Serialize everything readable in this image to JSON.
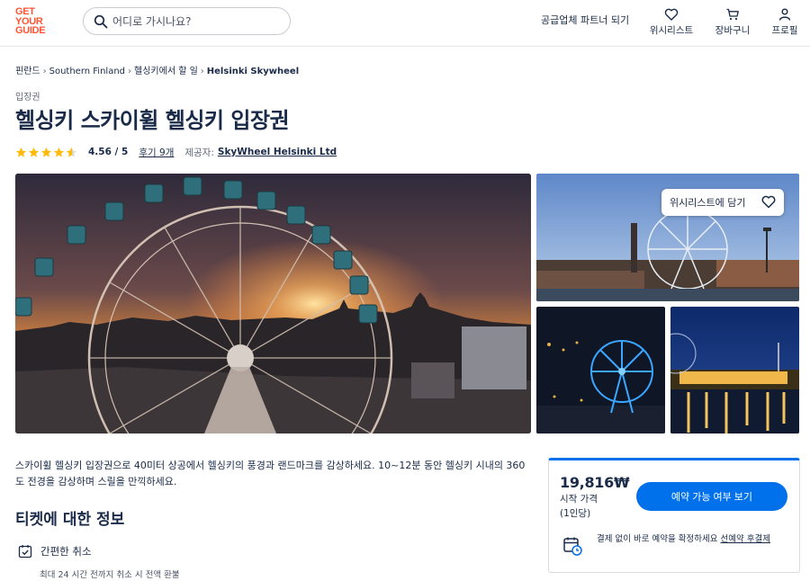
{
  "header": {
    "logo_lines": [
      "GET",
      "YOUR",
      "GUIDE"
    ],
    "search_placeholder": "어디로 가시나요?",
    "partner_link": "공급업체 파트너 되기",
    "nav": [
      {
        "label": "위시리스트",
        "icon": "heart-icon"
      },
      {
        "label": "장바구니",
        "icon": "cart-icon"
      },
      {
        "label": "프로필",
        "icon": "profile-icon"
      }
    ]
  },
  "breadcrumb": [
    "핀란드",
    "Southern Finland",
    "헬싱키에서 할 일",
    "Helsinki Skywheel"
  ],
  "product": {
    "category": "입장권",
    "title": "헬싱키 스카이휠 헬싱키 입장권",
    "rating_value": "4.56 / 5",
    "rating_stars": 4.56,
    "reviews": "후기 9개",
    "provider_label": "제공자:",
    "provider_name": "SkyWheel Helsinki Ltd"
  },
  "gallery": {
    "wishlist_button": "위시리스트에 담기"
  },
  "description": "스카이휠 헬싱키 입장권으로 40미터 상공에서 헬싱키의 풍경과 랜드마크를 감상하세요. 10~12분 동안 헬싱키 시내의 360도 전경을 감상하며 스릴을 만끽하세요.",
  "ticket_info": {
    "title": "티켓에 대한 정보",
    "feature_title": "간편한 취소",
    "feature_sub": "최대 24 시간 전까지 취소 시 전액 환불"
  },
  "booking": {
    "price": "19,816₩",
    "price_label": "시작 가격",
    "per_person": "(1인당)",
    "check_button": "예약 가능 여부 보기",
    "reserve_text": "결제 없이 바로 예약을 확정하세요 ",
    "reserve_link": "선예약 후결제"
  },
  "colors": {
    "brand": "#ff5533",
    "primary_button": "#0071eb",
    "star": "#ffba0a",
    "text": "#1a2b49"
  }
}
